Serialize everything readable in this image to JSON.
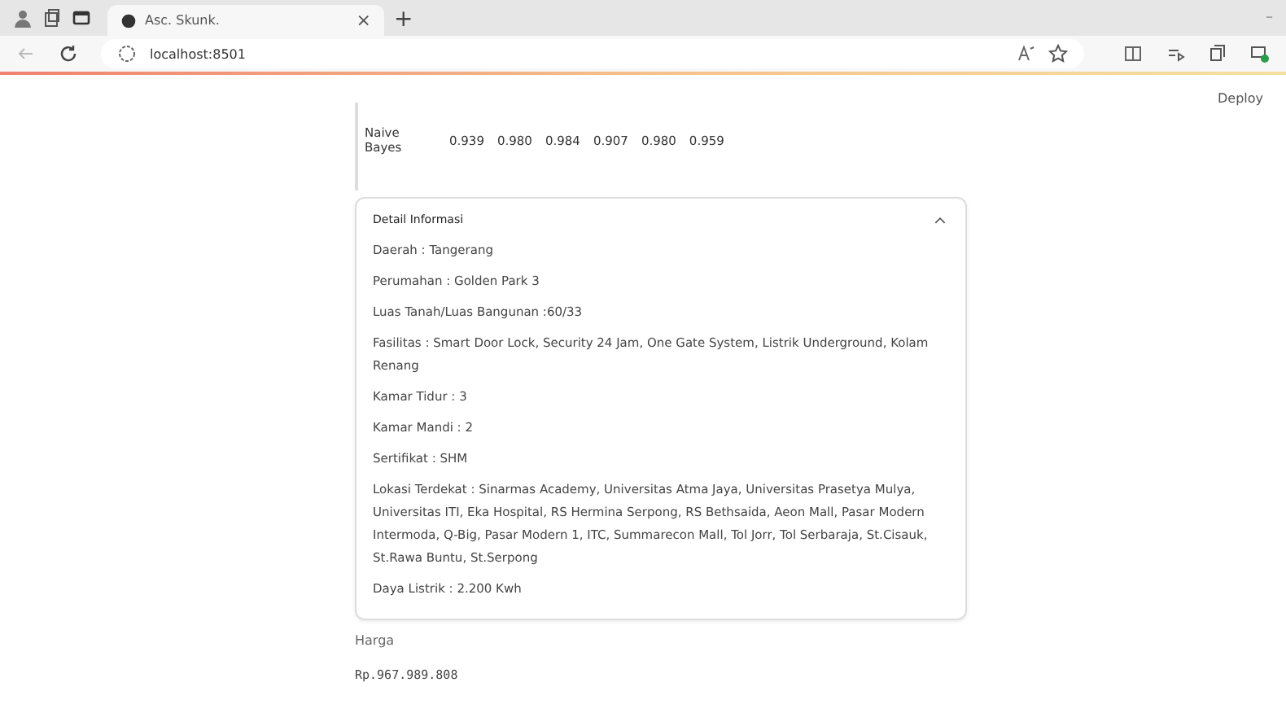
{
  "browser": {
    "tab": {
      "title": "Asc. Skunk.",
      "close": "×"
    },
    "new_tab": "+",
    "url": "localhost:8501",
    "window_minimize": "–"
  },
  "app": {
    "deploy": "Deploy",
    "table": {
      "rows": [
        {
          "cells": [
            "Naive Bayes",
            "0.939",
            "0.980",
            "0.984",
            "0.907",
            "0.980",
            "0.959"
          ]
        }
      ]
    },
    "expander": {
      "title": "Detail Informasi",
      "expanded": true,
      "items": [
        "Daerah : Tangerang",
        "Perumahan : Golden Park 3",
        "Luas Tanah/Luas Bangunan :60/33",
        "Fasilitas : Smart Door Lock, Security 24 Jam, One Gate System, Listrik Underground, Kolam Renang",
        "Kamar Tidur : 3",
        "Kamar Mandi : 2",
        "Sertifikat : SHM",
        "Lokasi Terdekat : Sinarmas Academy, Universitas Atma Jaya, Universitas Prasetya Mulya, Universitas ITI, Eka Hospital, RS Hermina Serpong, RS Bethsaida, Aeon Mall, Pasar Modern Intermoda, Q-Big, Pasar Modern 1, ITC, Summarecon Mall, Tol Jorr, Tol Serbaraja, St.Cisauk, St.Rawa Buntu, St.Serpong",
        "Daya Listrik : 2.200 Kwh"
      ]
    },
    "price_label": "Harga",
    "price": "Rp.967.989.808"
  }
}
